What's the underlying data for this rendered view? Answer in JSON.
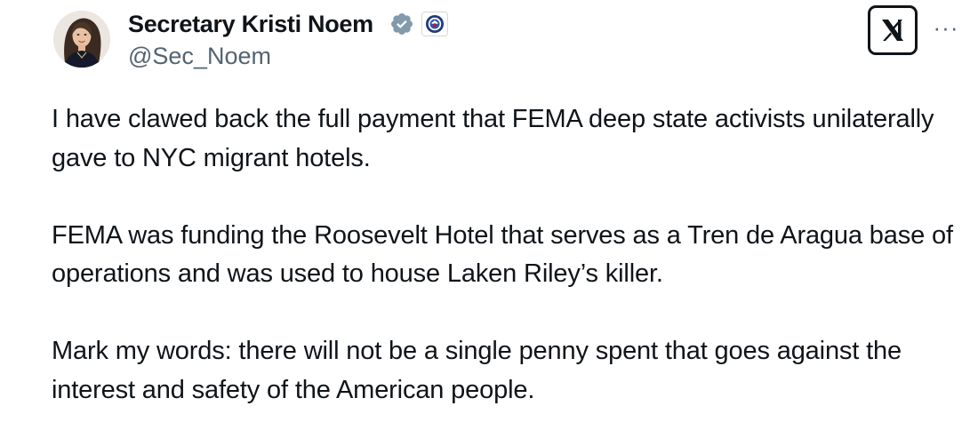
{
  "author": {
    "display_name": "Secretary Kristi Noem",
    "handle": "@Sec_Noem",
    "verified": true,
    "verified_badge_color": "#829aab",
    "affiliation_badge": "dhs-seal-icon",
    "avatar": "profile-photo"
  },
  "header": {
    "platform_logo": "x-logo-icon",
    "more_menu": "more-options-icon",
    "more_label": "···"
  },
  "tweet": {
    "paragraphs": [
      "I have clawed back the full payment that FEMA deep state activists unilaterally gave to NYC migrant hotels.",
      "FEMA was funding the Roosevelt Hotel that serves as a Tren de Aragua base of operations and was used to house Laken Riley’s killer.",
      "Mark my words: there will not be a single penny spent that goes against the interest and safety of the American people."
    ]
  },
  "colors": {
    "text_primary": "#0f1419",
    "text_secondary": "#536471",
    "background": "#ffffff"
  }
}
